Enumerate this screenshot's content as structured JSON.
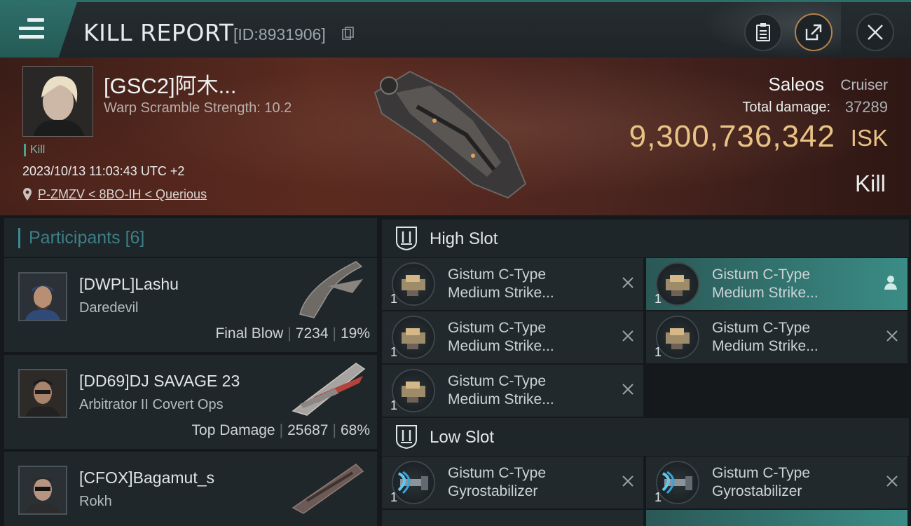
{
  "header": {
    "title": "KILL REPORT",
    "report_id": "[ID:8931906]",
    "icons": [
      "menu-icon",
      "clipboard-icon",
      "share-icon",
      "close-icon"
    ]
  },
  "victim": {
    "name": "[GSC2]阿木...",
    "stat": "Warp Scramble Strength: 10.2",
    "tag": "Kill",
    "datetime": "2023/10/13 11:03:43 UTC +2",
    "location": "P-ZMZV < 8BO-IH < Querious",
    "ship_name": "Saleos",
    "ship_class": "Cruiser",
    "damage_label": "Total damage:",
    "damage_value": "37289",
    "isk_value": "9,300,736,342",
    "isk_unit": "ISK",
    "result": "Kill"
  },
  "participants": {
    "title": "Participants",
    "count": "[6]",
    "rows": [
      {
        "name": "[DWPL]Lashu",
        "ship": "Daredevil",
        "label": "Final Blow",
        "damage": "7234",
        "percent": "19%",
        "badge": false
      },
      {
        "name": "[DD69]DJ SAVAGE 23",
        "ship": "Arbitrator II Covert Ops",
        "label": "Top Damage",
        "damage": "25687",
        "percent": "68%",
        "badge": true
      },
      {
        "name": "[CFOX]Bagamut_s",
        "ship": "Rokh",
        "label": "",
        "damage": "",
        "percent": "",
        "badge": true
      }
    ]
  },
  "fitting": {
    "high_title": "High Slot",
    "low_title": "Low Slot",
    "high": [
      {
        "line1": "Gistum C-Type",
        "line2": "Medium Strike...",
        "qty": "1",
        "status": "destroyed"
      },
      {
        "line1": "Gistum C-Type",
        "line2": "Medium Strike...",
        "qty": "1",
        "status": "dropped"
      },
      {
        "line1": "Gistum C-Type",
        "line2": "Medium Strike...",
        "qty": "1",
        "status": "destroyed"
      },
      {
        "line1": "Gistum C-Type",
        "line2": "Medium Strike...",
        "qty": "1",
        "status": "destroyed"
      },
      {
        "line1": "Gistum C-Type",
        "line2": "Medium Strike...",
        "qty": "1",
        "status": "destroyed"
      }
    ],
    "low": [
      {
        "line1": "Gistum C-Type",
        "line2": "Gyrostabilizer",
        "qty": "1",
        "status": "destroyed"
      },
      {
        "line1": "Gistum C-Type",
        "line2": "Gyrostabilizer",
        "qty": "1",
        "status": "destroyed"
      }
    ]
  },
  "colors": {
    "accent": "#2f6e69",
    "isk": "#e9c384",
    "active_module": "#3b8c86"
  }
}
